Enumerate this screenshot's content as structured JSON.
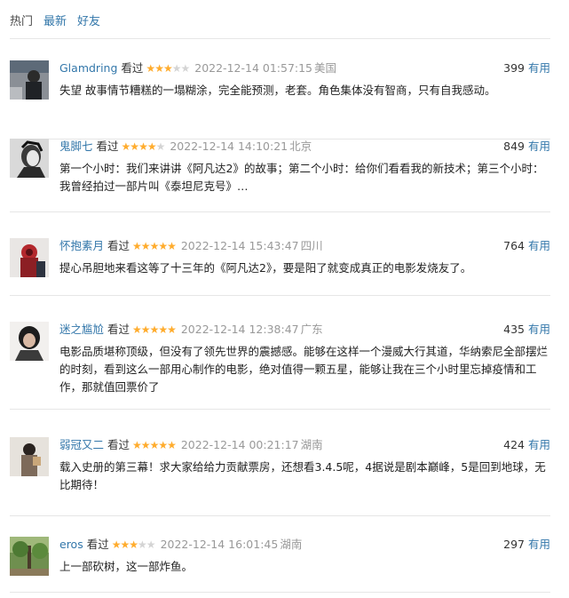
{
  "tabs": [
    {
      "label": "热门"
    },
    {
      "label": "最新"
    },
    {
      "label": "好友"
    }
  ],
  "colors": {
    "link": "#3377aa",
    "star_on": "#ffac2d",
    "star_off": "#d4d4d4",
    "meta": "#999999",
    "divider": "#e6e6e6"
  },
  "comments": [
    {
      "user": "Glamdring",
      "status": "看过",
      "rating": 3,
      "time": "2022-12-14 01:57:15",
      "location": "美国",
      "votes": "399",
      "vote_label": "有用",
      "text": "失望 故事情节糟糕的一塌糊涂，完全能预测，老套。角色集体没有智商，只有自我感动。",
      "avatar_icon": "user-avatar-icon"
    },
    {
      "user": "鬼脚七",
      "status": "看过",
      "rating": 4,
      "time": "2022-12-14 14:10:21",
      "location": "北京",
      "votes": "849",
      "vote_label": "有用",
      "text": "第一个小时：我们来讲讲《阿凡达2》的故事；第二个小时：给你们看看我的新技术；第三个小时：我曾经拍过一部片叫《泰坦尼克号》…",
      "avatar_icon": "user-avatar-icon"
    },
    {
      "user": "怀抱素月",
      "status": "看过",
      "rating": 5,
      "time": "2022-12-14 15:43:47",
      "location": "四川",
      "votes": "764",
      "vote_label": "有用",
      "text": "提心吊胆地来看这等了十三年的《阿凡达2》，要是阳了就变成真正的电影发烧友了。",
      "avatar_icon": "user-avatar-icon"
    },
    {
      "user": "迷之尴尬",
      "status": "看过",
      "rating": 5,
      "time": "2022-12-14 12:38:47",
      "location": "广东",
      "votes": "435",
      "vote_label": "有用",
      "text": "电影品质堪称顶级，但没有了领先世界的震撼感。能够在这样一个漫威大行其道，华纳索尼全部摆烂的时刻，看到这么一部用心制作的电影，绝对值得一颗五星，能够让我在三个小时里忘掉疫情和工作，那就值回票价了",
      "avatar_icon": "user-avatar-icon"
    },
    {
      "user": "弱冠又二",
      "status": "看过",
      "rating": 5,
      "time": "2022-12-14 00:21:17",
      "location": "湖南",
      "votes": "424",
      "vote_label": "有用",
      "text": "载入史册的第三幕！求大家给给力贡献票房，还想看3.4.5呢，4据说是剧本巅峰，5是回到地球，无比期待！",
      "avatar_icon": "user-avatar-icon"
    },
    {
      "user": "eros",
      "status": "看过",
      "rating": 3,
      "time": "2022-12-14 16:01:45",
      "location": "湖南",
      "votes": "297",
      "vote_label": "有用",
      "text": "上一部砍树，这一部炸鱼。",
      "avatar_icon": "user-avatar-icon"
    }
  ]
}
